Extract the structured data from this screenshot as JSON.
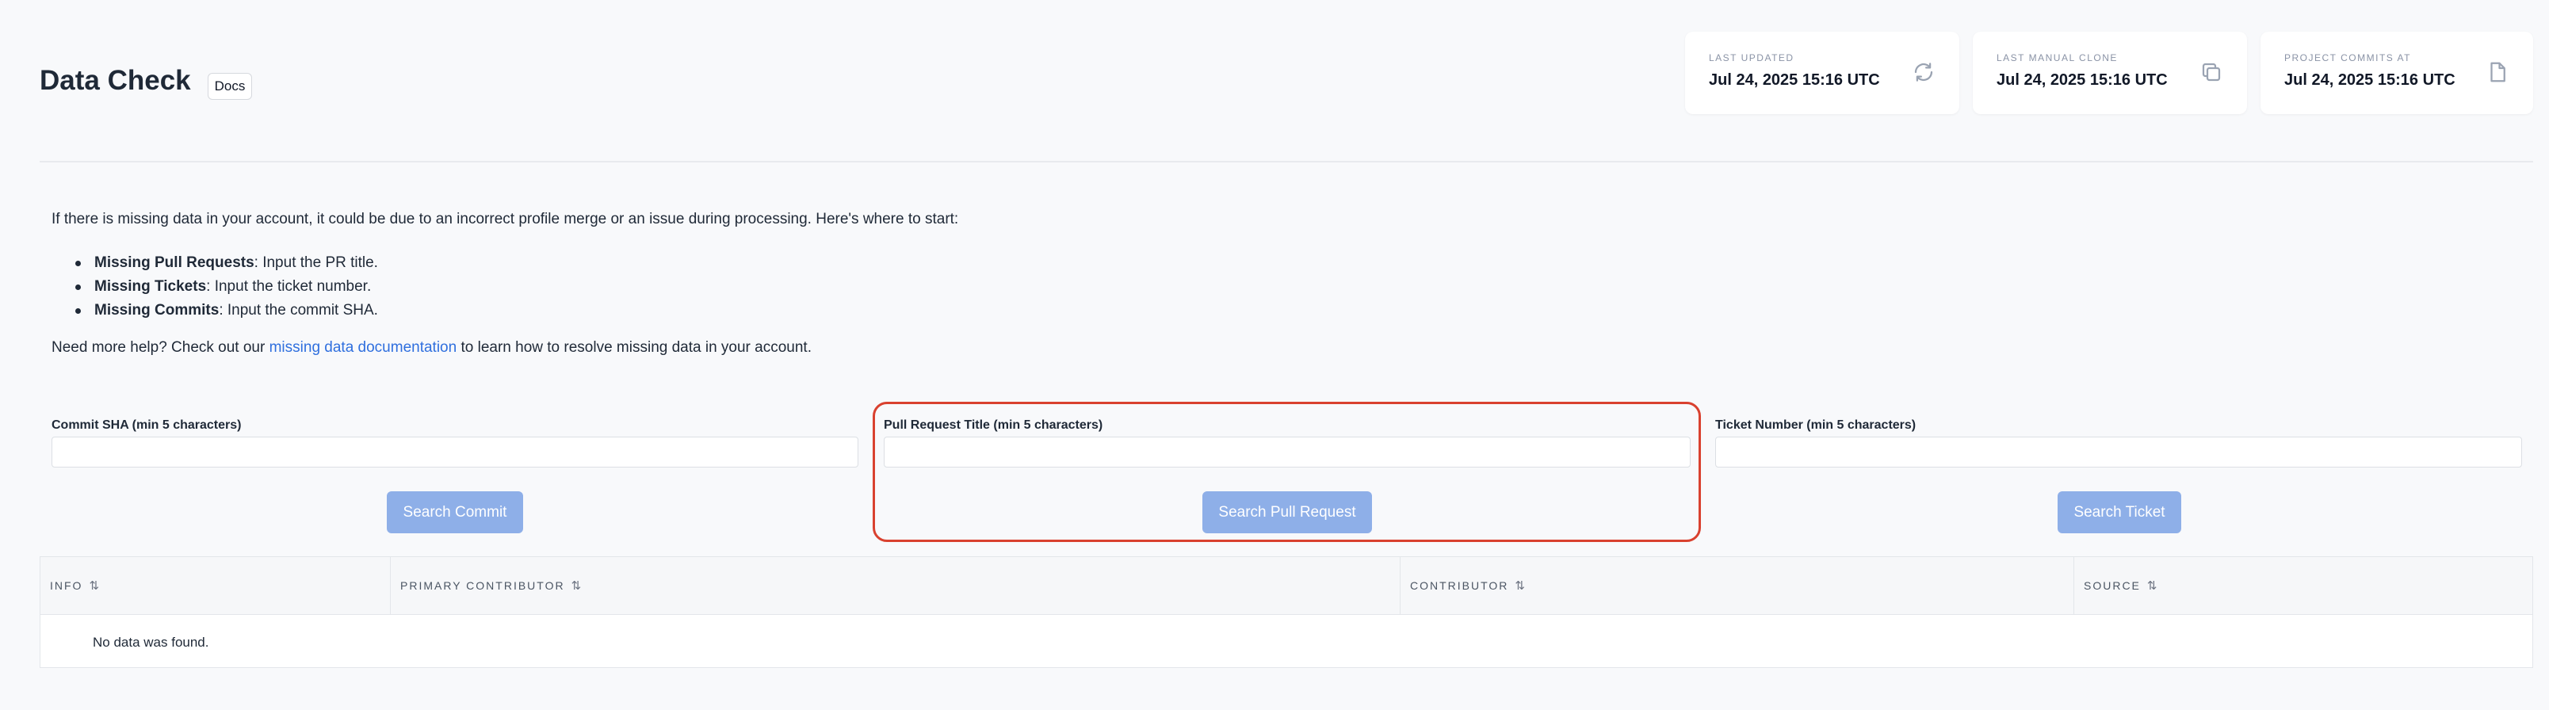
{
  "header": {
    "title": "Data Check",
    "docs_label": "Docs"
  },
  "stats": [
    {
      "label": "LAST UPDATED",
      "value": "Jul 24, 2025 15:16 UTC",
      "icon": "refresh-icon"
    },
    {
      "label": "LAST MANUAL CLONE",
      "value": "Jul 24, 2025 15:16 UTC",
      "icon": "copy-icon"
    },
    {
      "label": "PROJECT COMMITS AT",
      "value": "Jul 24, 2025 15:16 UTC",
      "icon": "file-icon"
    }
  ],
  "intro": {
    "text": "If there is missing data in your account, it could be due to an incorrect profile merge or an issue during processing. Here's where to start:",
    "bullets": [
      {
        "bold": "Missing Pull Requests",
        "rest": ": Input the PR title."
      },
      {
        "bold": "Missing Tickets",
        "rest": ": Input the ticket number."
      },
      {
        "bold": "Missing Commits",
        "rest": ": Input the commit SHA."
      }
    ],
    "help_prefix": "Need more help? Check out our ",
    "help_link": "missing data documentation",
    "help_suffix": " to learn how to resolve missing data in your account."
  },
  "search": {
    "commit": {
      "label": "Commit SHA (min 5 characters)",
      "value": "",
      "button": "Search Commit"
    },
    "pull_request": {
      "label": "Pull Request Title (min 5 characters)",
      "value": "",
      "button": "Search Pull Request"
    },
    "ticket": {
      "label": "Ticket Number (min 5 characters)",
      "value": "",
      "button": "Search Ticket"
    }
  },
  "table": {
    "columns": [
      "INFO",
      "PRIMARY CONTRIBUTOR",
      "CONTRIBUTOR",
      "SOURCE"
    ],
    "sort_glyph": "⇅",
    "empty_text": "No data was found."
  },
  "colors": {
    "button_bg": "#8eafe8",
    "highlight_border": "#d9412f",
    "link": "#2f6fde"
  }
}
